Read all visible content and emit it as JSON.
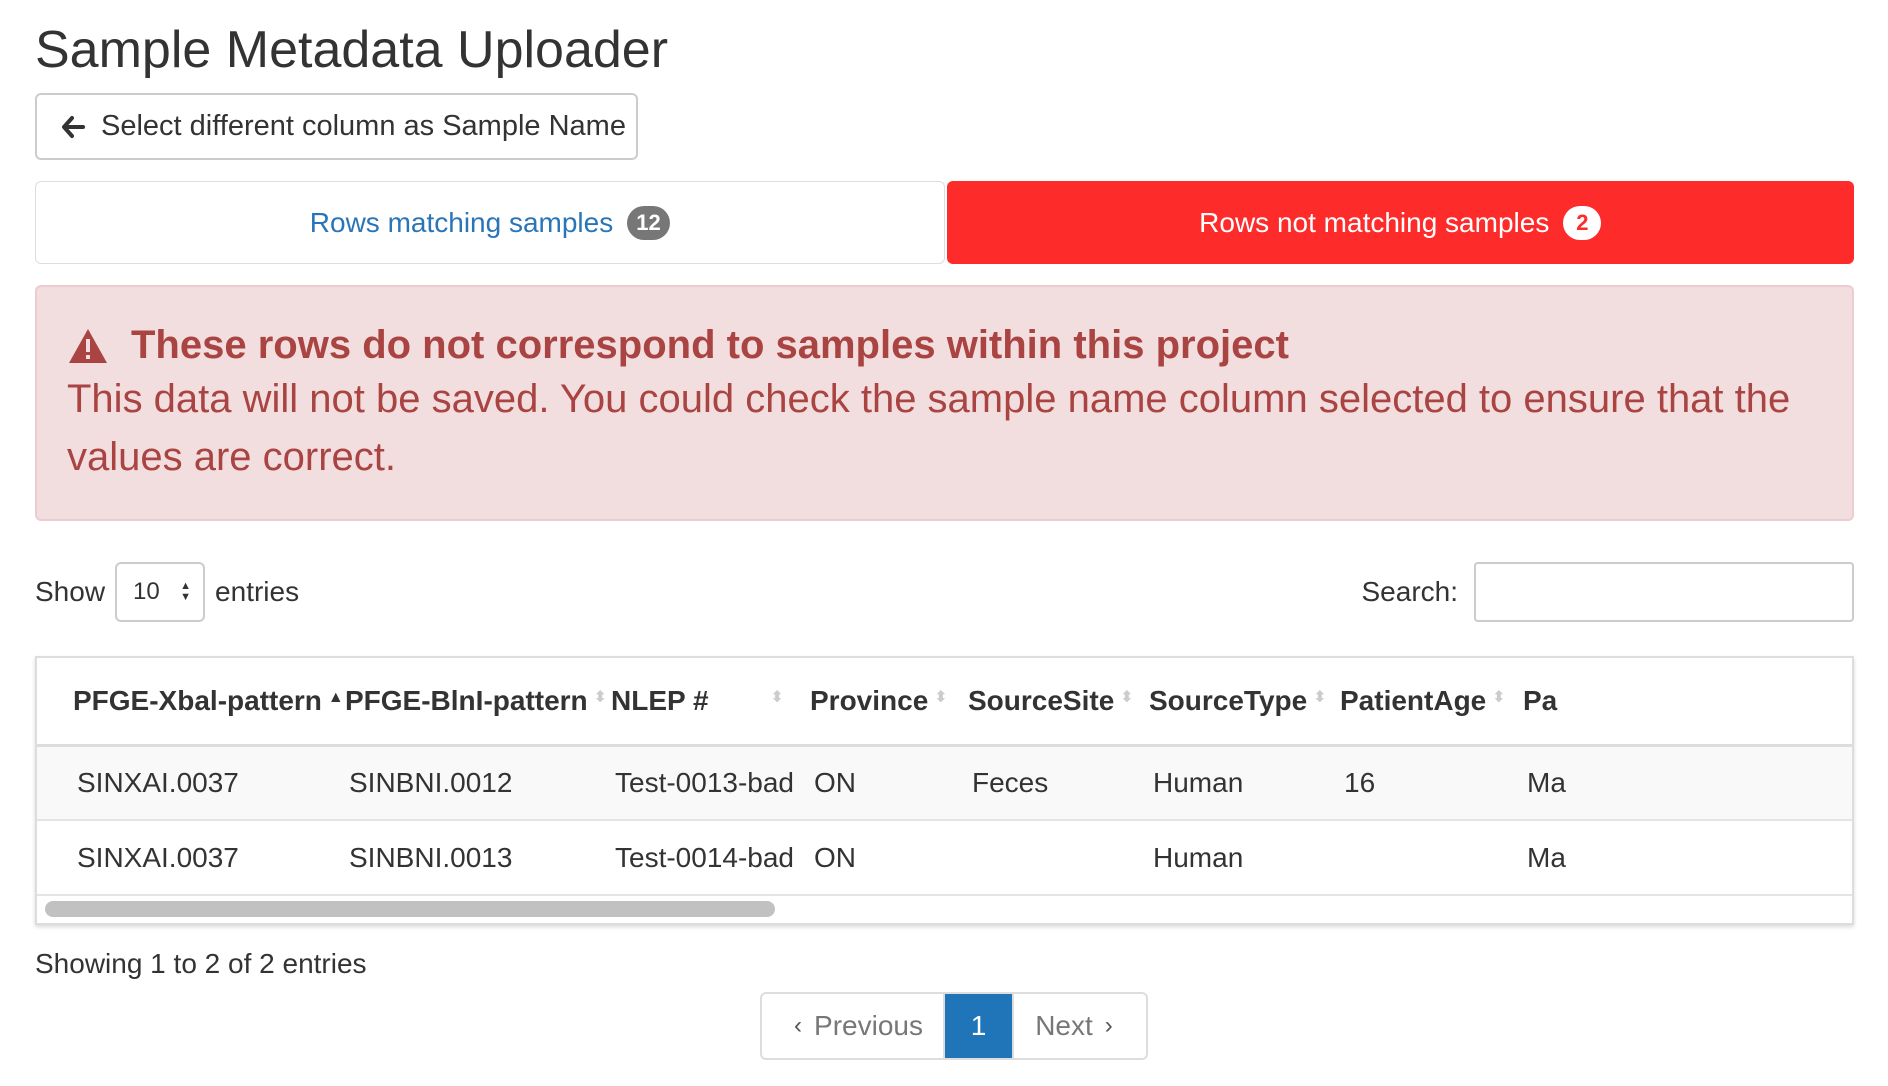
{
  "page": {
    "title": "Sample Metadata Uploader"
  },
  "back_button": {
    "label": "Select different column as Sample Name",
    "icon": "arrow-left-icon"
  },
  "tabs": [
    {
      "label": "Rows matching samples",
      "count": "12",
      "active": false
    },
    {
      "label": "Rows not matching samples",
      "count": "2",
      "active": true
    }
  ],
  "alert": {
    "icon": "warning-triangle-icon",
    "title": "These rows do not correspond to samples within this project",
    "body": "This data will not be saved. You could check the sample name column selected to ensure that the values are correct."
  },
  "length": {
    "prefix": "Show",
    "value": "10",
    "suffix": "entries"
  },
  "search": {
    "label": "Search:",
    "value": "",
    "placeholder": ""
  },
  "table": {
    "columns": [
      "PFGE-Xbal-pattern",
      "PFGE-BlnI-pattern",
      "NLEP #",
      "Province",
      "SourceSite",
      "SourceType",
      "PatientAge",
      "Pa"
    ],
    "sorted_column": "PFGE-Xbal-pattern",
    "rows": [
      [
        "SINXAI.0037",
        "SINBNI.0012",
        "Test-0013-bad",
        "ON",
        "Feces",
        "Human",
        "16",
        "Ma"
      ],
      [
        "SINXAI.0037",
        "SINBNI.0013",
        "Test-0014-bad",
        "ON",
        "",
        "Human",
        "",
        "Ma"
      ]
    ]
  },
  "info": "Showing 1 to 2 of 2 entries",
  "pagination": {
    "previous": "Previous",
    "current": "1",
    "next": "Next"
  },
  "colors": {
    "danger": "#fe2b2b",
    "link": "#2a75b8",
    "alert_bg": "#f2dedf",
    "alert_text": "#a94442",
    "pager_active": "#1f75b8"
  }
}
